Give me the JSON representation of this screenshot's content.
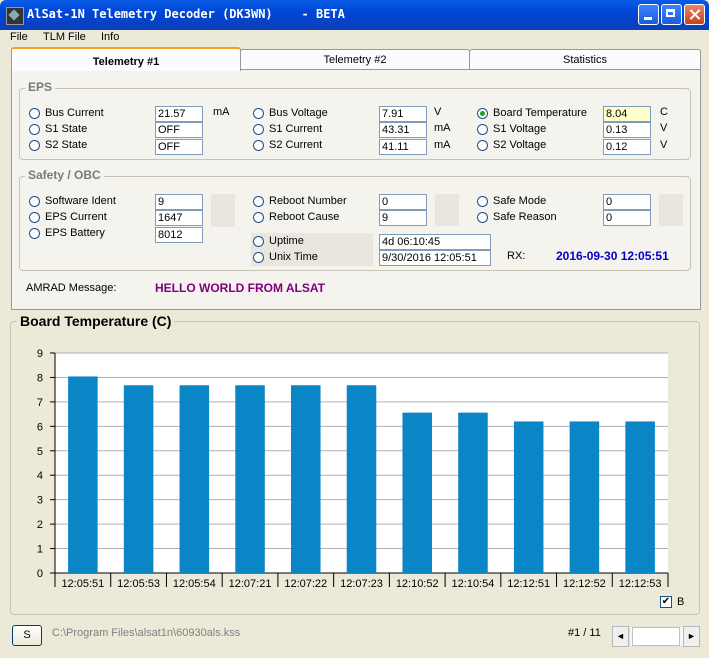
{
  "window": {
    "title": "AlSat-1N Telemetry Decoder (DK3WN)    - BETA"
  },
  "menu": [
    "File",
    "TLM File",
    "Info"
  ],
  "tabs": [
    "Telemetry #1",
    "Telemetry #2",
    "Statistics"
  ],
  "eps": {
    "title": "EPS",
    "items": [
      {
        "label": "Bus Current",
        "value": "21.57",
        "unit": "mA",
        "selected": false
      },
      {
        "label": "S1 State",
        "value": "OFF",
        "unit": "",
        "selected": false
      },
      {
        "label": "S2 State",
        "value": "OFF",
        "unit": "",
        "selected": false
      },
      {
        "label": "Bus Voltage",
        "value": "7.91",
        "unit": "V",
        "selected": false
      },
      {
        "label": "S1 Current",
        "value": "43.31",
        "unit": "mA",
        "selected": false
      },
      {
        "label": "S2 Current",
        "value": "41.11",
        "unit": "mA",
        "selected": false
      },
      {
        "label": "Board Temperature",
        "value": "8.04",
        "unit": "C",
        "selected": true
      },
      {
        "label": "S1 Voltage",
        "value": "0.13",
        "unit": "V",
        "selected": false
      },
      {
        "label": "S2 Voltage",
        "value": "0.12",
        "unit": "V",
        "selected": false
      }
    ]
  },
  "safety": {
    "title": "Safety / OBC",
    "items": [
      {
        "label": "Software Ident",
        "value": "9"
      },
      {
        "label": "EPS Current",
        "value": "1647"
      },
      {
        "label": "EPS Battery",
        "value": "8012"
      },
      {
        "label": "Reboot Number",
        "value": "0"
      },
      {
        "label": "Reboot Cause",
        "value": "9"
      },
      {
        "label": "Safe Mode",
        "value": "0"
      },
      {
        "label": "Safe Reason",
        "value": "0"
      },
      {
        "label": "Uptime",
        "value": "4d 06:10:45"
      },
      {
        "label": "Unix Time",
        "value": "9/30/2016 12:05:51"
      }
    ],
    "rx_label": "RX:",
    "rx_value": "2016-09-30 12:05:51"
  },
  "amrad": {
    "label": "AMRAD Message:",
    "value": "HELLO WORLD FROM ALSAT"
  },
  "chart_data": {
    "type": "bar",
    "title": "Board Temperature (C)",
    "categories": [
      "12:05:51",
      "12:05:53",
      "12:05:54",
      "12:07:21",
      "12:07:22",
      "12:07:23",
      "12:10:52",
      "12:10:54",
      "12:12:51",
      "12:12:52",
      "12:12:53"
    ],
    "values": [
      8.04,
      7.68,
      7.68,
      7.68,
      7.68,
      7.68,
      6.56,
      6.56,
      6.2,
      6.2,
      6.2
    ],
    "ylim": [
      0,
      9
    ],
    "yticks": [
      "0",
      "1",
      "2",
      "3",
      "4",
      "5",
      "6",
      "7",
      "8",
      "9"
    ],
    "grid": true,
    "bar_color": "#0a85c6"
  },
  "checkbox": {
    "label": "B",
    "checked": true
  },
  "bottom": {
    "s_button": "S",
    "file_path": "C:\\Program Files\\alsat1n\\60930als.kss",
    "page": "#1 / 11"
  },
  "icons": {
    "scroll_left": "◄",
    "scroll_right": "►",
    "check": "✔"
  }
}
